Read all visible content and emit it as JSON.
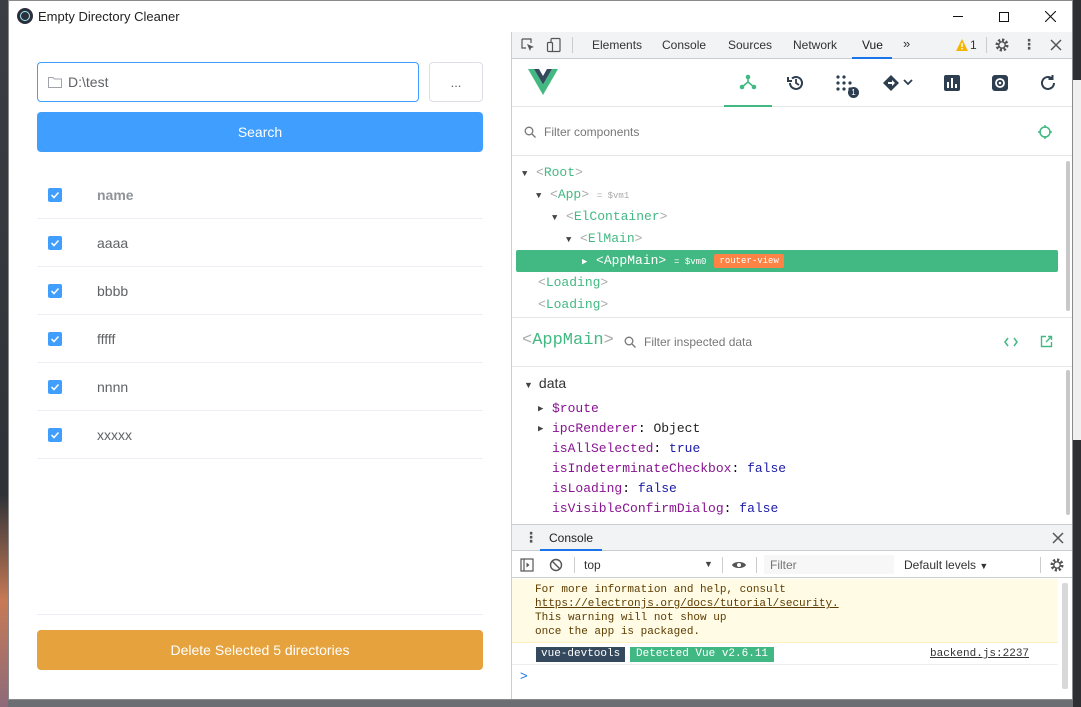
{
  "window": {
    "title": "Empty Directory Cleaner"
  },
  "app": {
    "path_value": "D:\\test",
    "browse_label": "...",
    "search_label": "Search",
    "table_header": "name",
    "rows": [
      "aaaa",
      "bbbb",
      "fffff",
      "nnnn",
      "xxxxx"
    ],
    "delete_label": "Delete Selected 5 directories"
  },
  "devtools": {
    "tabs": [
      "Elements",
      "Console",
      "Sources",
      "Network",
      "Vue"
    ],
    "active_tab": "Vue",
    "warning_count": "1",
    "vue": {
      "timeline_badge": "1",
      "filter_components_placeholder": "Filter components",
      "tree": {
        "root": "Root",
        "app": "App",
        "app_vm": "= $vm1",
        "container": "ElContainer",
        "main": "ElMain",
        "appmain": "AppMain",
        "appmain_vm": "= $vm0",
        "router_tag": "router-view",
        "loading1": "Loading",
        "loading2": "Loading"
      },
      "inspected_name": "AppMain",
      "filter_inspected_placeholder": "Filter inspected data",
      "data_section": "data",
      "data": [
        {
          "key": "$route",
          "sep": ":",
          "value": "",
          "kind": "obj",
          "expandable": true
        },
        {
          "key": "ipcRenderer",
          "sep": ":",
          "value": "Object",
          "kind": "obj",
          "expandable": true
        },
        {
          "key": "isAllSelected",
          "sep": ":",
          "value": "true",
          "kind": "bool",
          "expandable": false
        },
        {
          "key": "isIndeterminateCheckbox",
          "sep": ":",
          "value": "false",
          "kind": "bool",
          "expandable": false
        },
        {
          "key": "isLoading",
          "sep": ":",
          "value": "false",
          "kind": "bool",
          "expandable": false
        },
        {
          "key": "isVisibleConfirmDialog",
          "sep": ":",
          "value": "false",
          "kind": "bool",
          "expandable": false
        }
      ]
    },
    "console": {
      "tab_label": "Console",
      "context": "top",
      "filter_placeholder": "Filter",
      "levels": "Default levels",
      "warning_lines": [
        "For more information and help, consult",
        "https://electronjs.org/docs/tutorial/security.",
        "This warning will not show up",
        "once the app is packaged."
      ],
      "tag1": "vue-devtools",
      "tag2": "Detected Vue v2.6.11",
      "source": "backend.js:2237",
      "prompt": ">"
    }
  },
  "colors": {
    "primary": "#409eff",
    "warning": "#e6a23c",
    "vue_green": "#42b983",
    "vue_dark": "#35495e"
  }
}
